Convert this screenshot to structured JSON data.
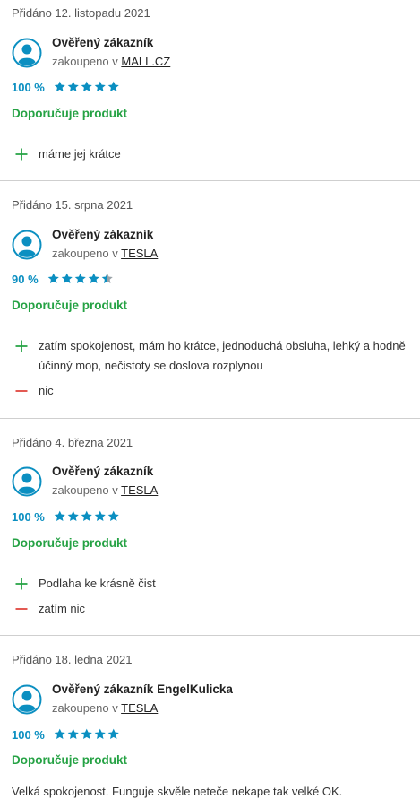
{
  "reviews": [
    {
      "date": "Přidáno 12. listopadu 2021",
      "author": "Ověřený zákazník",
      "bought_prefix": "zakoupeno v",
      "shop": "MALL.CZ",
      "percent": "100 %",
      "rating": 5,
      "recommend": "Doporučuje produkt",
      "pros": [
        "máme jej krátce"
      ],
      "cons": []
    },
    {
      "date": "Přidáno 15. srpna 2021",
      "author": "Ověřený zákazník",
      "bought_prefix": "zakoupeno v",
      "shop": "TESLA",
      "percent": "90 %",
      "rating": 4.5,
      "recommend": "Doporučuje produkt",
      "pros": [
        "zatím spokojenost, mám ho krátce, jednoduchá obsluha, lehký a hodně účinný mop, nečistoty se doslova rozplynou"
      ],
      "cons": [
        "nic"
      ]
    },
    {
      "date": "Přidáno 4. března 2021",
      "author": "Ověřený zákazník",
      "bought_prefix": "zakoupeno v",
      "shop": "TESLA",
      "percent": "100 %",
      "rating": 5,
      "recommend": "Doporučuje produkt",
      "pros": [
        "Podlaha ke krásně čist"
      ],
      "cons": [
        "zatím nic"
      ]
    },
    {
      "date": "Přidáno 18. ledna 2021",
      "author": "Ověřený zákazník EngelKulicka",
      "bought_prefix": "zakoupeno v",
      "shop": "TESLA",
      "percent": "100 %",
      "rating": 5,
      "recommend": "Doporučuje produkt",
      "text": "Velká spokojenost. Funguje skvěle neteče nekape tak velké OK."
    }
  ],
  "colors": {
    "accent_blue": "#0b8fc1",
    "recommend_green": "#25a244",
    "con_red": "#e0473f",
    "star_grey": "#9aa3a8"
  },
  "icons": {
    "avatar": "user-avatar-icon",
    "star": "star-icon",
    "pro": "plus-icon",
    "con": "minus-icon"
  }
}
